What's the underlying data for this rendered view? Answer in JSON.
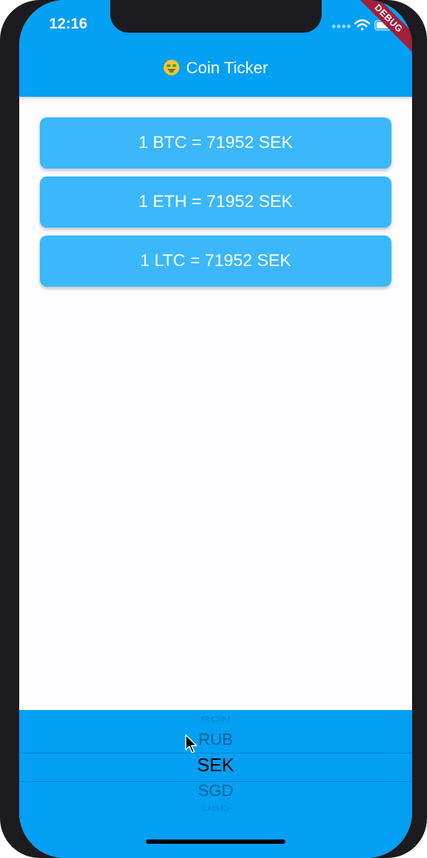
{
  "status_bar": {
    "time": "12:16",
    "icons": [
      "signal-dots-icon",
      "wifi-icon",
      "battery-icon"
    ]
  },
  "debug_banner": "DEBUG",
  "app_bar": {
    "emoji_icon": "money-mouth-face-icon",
    "title": "Coin Ticker",
    "color": "#03a0f4"
  },
  "cards": [
    {
      "label": "1 BTC = 71952 SEK"
    },
    {
      "label": "1 ETH = 71952 SEK"
    },
    {
      "label": "1 LTC = 71952 SEK"
    }
  ],
  "currency_picker": {
    "items_above": [
      "RON",
      "RUB"
    ],
    "selected": "SEK",
    "items_below": [
      "SGD",
      "USD"
    ]
  },
  "colors": {
    "card": "#3ab8fb",
    "accent": "#03a0f4"
  }
}
